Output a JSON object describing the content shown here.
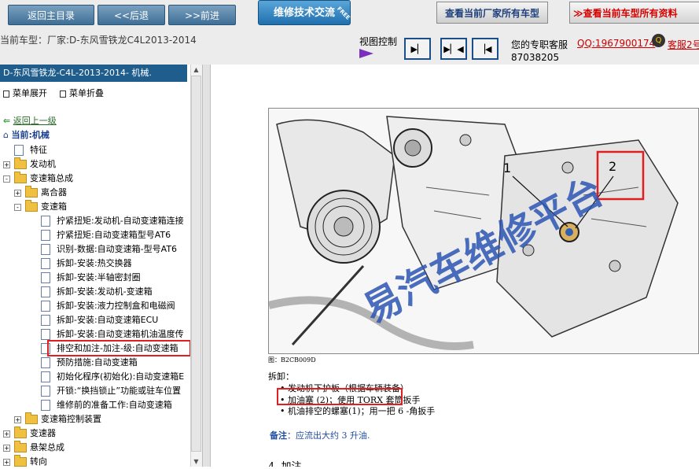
{
  "toolbar": {
    "back_home": "返回主目录",
    "back": "<<后退",
    "forward": ">>前进",
    "tech_exchange": "维修技术交流",
    "free_tag": "FREE",
    "mfr_models": "查看当前厂家所有车型",
    "all_models": "≫查看当前车型所有资料"
  },
  "statusbar": {
    "current_model": "当前车型：厂家:D-东风雪铁龙C4L2013-2014",
    "view_control": "视图控制",
    "service_label": "您的专职客服",
    "qq": "QQ:1967900174",
    "service2": "客服2号",
    "phone": "87038205"
  },
  "sidebar": {
    "breadcrumb": "D-东风雪铁龙-C4L-2013-2014- 机械.",
    "expand": "菜单展开",
    "collapse": "菜单折叠",
    "back_up": "返回上一级",
    "current": "当前:机械",
    "tree": [
      {
        "label": "特征",
        "kind": "page",
        "indent": 0
      },
      {
        "label": "发动机",
        "kind": "folder",
        "indent": 0,
        "toggle": "+"
      },
      {
        "label": "变速箱总成",
        "kind": "folder",
        "indent": 0,
        "toggle": "-"
      },
      {
        "label": "离合器",
        "kind": "folder",
        "indent": 1,
        "toggle": "+"
      },
      {
        "label": "变速箱",
        "kind": "folder",
        "indent": 1,
        "toggle": "-"
      },
      {
        "label": "拧紧扭矩:发动机-自动变速箱连接",
        "kind": "page",
        "indent": 2
      },
      {
        "label": "拧紧扭矩:自动变速箱型号AT6",
        "kind": "page",
        "indent": 2
      },
      {
        "label": "识别-数据:自动变速箱-型号AT6",
        "kind": "page",
        "indent": 2
      },
      {
        "label": "拆卸-安装:热交换器",
        "kind": "page",
        "indent": 2
      },
      {
        "label": "拆卸-安装:半轴密封圈",
        "kind": "page",
        "indent": 2
      },
      {
        "label": "拆卸-安装:发动机-变速箱",
        "kind": "page",
        "indent": 2
      },
      {
        "label": "拆卸-安装:液力控制盒和电磁阀",
        "kind": "page",
        "indent": 2
      },
      {
        "label": "拆卸-安装:自动变速箱ECU",
        "kind": "page",
        "indent": 2
      },
      {
        "label": "拆卸-安装:自动变速箱机油温度传",
        "kind": "page",
        "indent": 2
      },
      {
        "label": "排空和加注-加注-级:自动变速箱",
        "kind": "page",
        "indent": 2,
        "selected": true
      },
      {
        "label": "预防措施:自动变速箱",
        "kind": "page",
        "indent": 2
      },
      {
        "label": "初始化程序(初始化):自动变速箱E",
        "kind": "page",
        "indent": 2
      },
      {
        "label": "开锁:“换挡锁止”功能或驻车位置",
        "kind": "page",
        "indent": 2
      },
      {
        "label": "维修前的准备工作:自动变速箱",
        "kind": "page",
        "indent": 2
      },
      {
        "label": "变速箱控制装置",
        "kind": "folder",
        "indent": 1,
        "toggle": "+"
      },
      {
        "label": "变速器",
        "kind": "folder",
        "indent": 0,
        "toggle": "+"
      },
      {
        "label": "悬架总成",
        "kind": "folder",
        "indent": 0,
        "toggle": "+"
      },
      {
        "label": "转向",
        "kind": "folder",
        "indent": 0,
        "toggle": "+"
      }
    ]
  },
  "content": {
    "callout_1": "1",
    "callout_2": "2",
    "figure_caption": "图：B2CB009D",
    "section_label": "拆卸：",
    "bullets": [
      "发动机下护板（根据车辆装备）",
      "加油塞 (2)；使用 TORX 套筒扳手",
      "机油排空的螺塞(1)；用一把 6 -角扳手"
    ],
    "note_label": "备注",
    "note_text": "：应流出大约 3 升油.",
    "next_heading": "4. 加注",
    "watermark": "易汽车维修平台"
  },
  "colors": {
    "accent_blue": "#1f5d8c",
    "highlight_red": "#e02020",
    "link_red": "#d40000"
  }
}
